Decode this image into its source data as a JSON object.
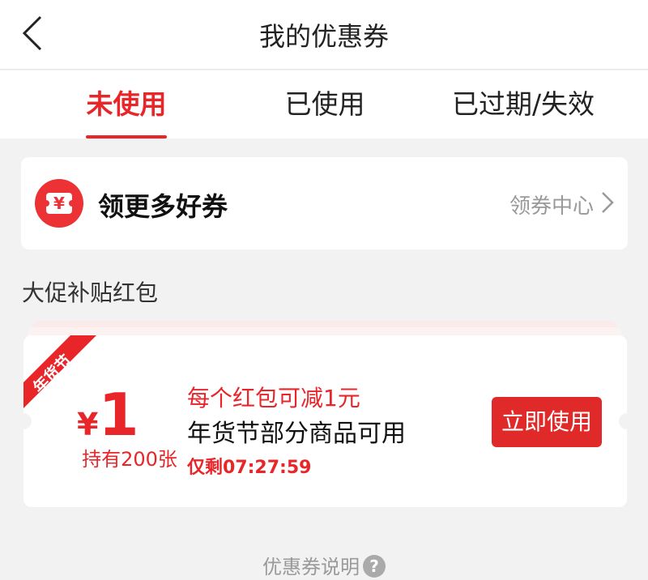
{
  "header": {
    "title": "我的优惠券"
  },
  "tabs": [
    {
      "label": "未使用",
      "active": true
    },
    {
      "label": "已使用",
      "active": false
    },
    {
      "label": "已过期/失效",
      "active": false
    }
  ],
  "more_coupons": {
    "icon": "ticket-yuan-icon",
    "icon_glyph": "¥",
    "title": "领更多好券",
    "link_label": "领券中心"
  },
  "section": {
    "title": "大促补贴红包"
  },
  "coupon": {
    "ribbon_label": "年货节",
    "currency": "¥",
    "amount": "1",
    "holding": "持有200张",
    "line1": "每个红包可减1元",
    "line2": "年货节部分商品可用",
    "line3": "仅剩07:27:59",
    "button_label": "立即使用"
  },
  "footer": {
    "link_label": "优惠券说明",
    "help_glyph": "?"
  },
  "colors": {
    "accent": "#e8262a",
    "button": "#e02a2a",
    "background": "#f2f2f2"
  }
}
